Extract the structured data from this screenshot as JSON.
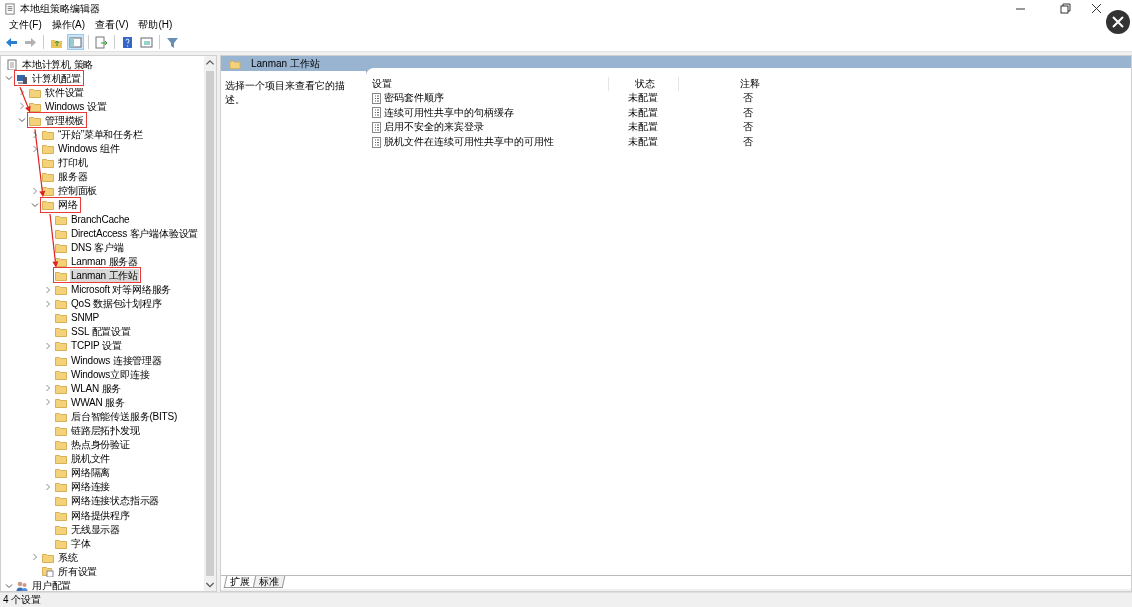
{
  "window": {
    "title": "本地组策略编辑器"
  },
  "menu": [
    "文件(F)",
    "操作(A)",
    "查看(V)",
    "帮助(H)"
  ],
  "toolbar": [
    {
      "kind": "back",
      "disabled": false,
      "pressed": false
    },
    {
      "kind": "forward",
      "disabled": true,
      "pressed": false
    },
    {
      "kind": "separator"
    },
    {
      "kind": "up",
      "disabled": false,
      "pressed": false
    },
    {
      "kind": "tree",
      "disabled": false,
      "pressed": true
    },
    {
      "kind": "separator"
    },
    {
      "kind": "export",
      "disabled": false,
      "pressed": false
    },
    {
      "kind": "separator"
    },
    {
      "kind": "help",
      "disabled": false,
      "pressed": false
    },
    {
      "kind": "pane",
      "disabled": false,
      "pressed": false
    },
    {
      "kind": "separator"
    },
    {
      "kind": "filter",
      "disabled": false,
      "pressed": false
    }
  ],
  "tree": [
    {
      "label": "本地计算机 策略",
      "kind": "policy",
      "selected": false,
      "highlighted": false
    },
    {
      "label": "计算机配置",
      "kind": "computer",
      "expanded": true,
      "selected": false,
      "highlighted": true,
      "children": [
        {
          "label": "软件设置",
          "kind": "folder",
          "expanded": false,
          "selected": false,
          "highlighted": false
        },
        {
          "label": "Windows 设置",
          "kind": "folder",
          "expanded": false,
          "selected": false,
          "highlighted": false
        },
        {
          "label": "管理模板",
          "kind": "folder",
          "expanded": true,
          "selected": false,
          "highlighted": true,
          "children": [
            {
              "label": "“开始”菜单和任务栏",
              "kind": "folder",
              "expanded": false,
              "selected": false,
              "highlighted": false
            },
            {
              "label": "Windows 组件",
              "kind": "folder",
              "expanded": false,
              "selected": false,
              "highlighted": false
            },
            {
              "label": "打印机",
              "kind": "folder",
              "selected": false,
              "highlighted": false
            },
            {
              "label": "服务器",
              "kind": "folder",
              "selected": false,
              "highlighted": false
            },
            {
              "label": "控制面板",
              "kind": "folder",
              "expanded": false,
              "selected": false,
              "highlighted": false
            },
            {
              "label": "网络",
              "kind": "folder",
              "expanded": true,
              "selected": false,
              "highlighted": true,
              "children": [
                {
                  "label": "BranchCache",
                  "kind": "folder",
                  "selected": false,
                  "highlighted": false
                },
                {
                  "label": "DirectAccess 客户端体验设置",
                  "kind": "folder",
                  "selected": false,
                  "highlighted": false
                },
                {
                  "label": "DNS 客户端",
                  "kind": "folder",
                  "selected": false,
                  "highlighted": false
                },
                {
                  "label": "Lanman 服务器",
                  "kind": "folder",
                  "selected": false,
                  "highlighted": false
                },
                {
                  "label": "Lanman 工作站",
                  "kind": "folder",
                  "selected": true,
                  "highlighted": true
                },
                {
                  "label": "Microsoft 对等网络服务",
                  "kind": "folder",
                  "expanded": false,
                  "selected": false,
                  "highlighted": false
                },
                {
                  "label": "QoS 数据包计划程序",
                  "kind": "folder",
                  "expanded": false,
                  "selected": false,
                  "highlighted": false
                },
                {
                  "label": "SNMP",
                  "kind": "folder",
                  "selected": false,
                  "highlighted": false
                },
                {
                  "label": "SSL 配置设置",
                  "kind": "folder",
                  "selected": false,
                  "highlighted": false
                },
                {
                  "label": "TCPIP 设置",
                  "kind": "folder",
                  "expanded": false,
                  "selected": false,
                  "highlighted": false
                },
                {
                  "label": "Windows 连接管理器",
                  "kind": "folder",
                  "selected": false,
                  "highlighted": false
                },
                {
                  "label": "Windows立即连接",
                  "kind": "folder",
                  "selected": false,
                  "highlighted": false
                },
                {
                  "label": "WLAN 服务",
                  "kind": "folder",
                  "expanded": false,
                  "selected": false,
                  "highlighted": false
                },
                {
                  "label": "WWAN 服务",
                  "kind": "folder",
                  "expanded": false,
                  "selected": false,
                  "highlighted": false
                },
                {
                  "label": "后台智能传送服务(BITS)",
                  "kind": "folder",
                  "selected": false,
                  "highlighted": false
                },
                {
                  "label": "链路层拓扑发现",
                  "kind": "folder",
                  "selected": false,
                  "highlighted": false
                },
                {
                  "label": "热点身份验证",
                  "kind": "folder",
                  "selected": false,
                  "highlighted": false
                },
                {
                  "label": "脱机文件",
                  "kind": "folder",
                  "selected": false,
                  "highlighted": false
                },
                {
                  "label": "网络隔离",
                  "kind": "folder",
                  "selected": false,
                  "highlighted": false
                },
                {
                  "label": "网络连接",
                  "kind": "folder",
                  "expanded": false,
                  "selected": false,
                  "highlighted": false
                },
                {
                  "label": "网络连接状态指示器",
                  "kind": "folder",
                  "selected": false,
                  "highlighted": false
                },
                {
                  "label": "网络提供程序",
                  "kind": "folder",
                  "selected": false,
                  "highlighted": false
                },
                {
                  "label": "无线显示器",
                  "kind": "folder",
                  "selected": false,
                  "highlighted": false
                },
                {
                  "label": "字体",
                  "kind": "folder",
                  "selected": false,
                  "highlighted": false
                }
              ]
            },
            {
              "label": "系统",
              "kind": "folder",
              "expanded": false,
              "selected": false,
              "highlighted": false
            },
            {
              "label": "所有设置",
              "kind": "settings",
              "selected": false,
              "highlighted": false
            }
          ]
        }
      ]
    },
    {
      "label": "用户配置",
      "kind": "user",
      "expanded": true,
      "selected": false,
      "highlighted": false
    }
  ],
  "details": {
    "title": "Lanman 工作站",
    "description": "选择一个项目来查看它的描述。"
  },
  "table": {
    "columns": [
      "设置",
      "状态",
      "注释"
    ],
    "rows": [
      [
        "密码套件顺序",
        "未配置",
        "否"
      ],
      [
        "连续可用性共享中的句柄缓存",
        "未配置",
        "否"
      ],
      [
        "启用不安全的来宾登录",
        "未配置",
        "否"
      ],
      [
        "脱机文件在连续可用性共享中的可用性",
        "未配置",
        "否"
      ]
    ]
  },
  "view_tabs": [
    {
      "label": "扩展",
      "selected": true
    },
    {
      "label": "标准",
      "selected": false
    }
  ],
  "status_bar": "4 个设置"
}
